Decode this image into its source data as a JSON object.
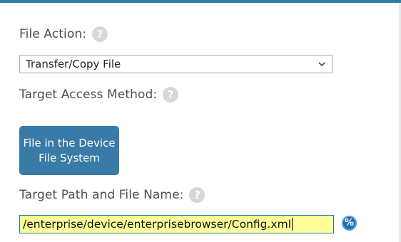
{
  "colors": {
    "accent_bar": "#2f7fa7",
    "button_bg": "#3a7aa6",
    "input_highlight": "#ffff99",
    "help_icon": "#d7d7d7"
  },
  "file_action": {
    "label": "File Action:",
    "help_icon": "?",
    "selected": "Transfer/Copy File",
    "chevron": "⌄"
  },
  "target_access": {
    "label": "Target Access Method:",
    "help_icon": "?",
    "button_line1": "File in the Device",
    "button_line2": "File System"
  },
  "target_path": {
    "label": "Target Path and File Name:",
    "help_icon": "?",
    "value": "/enterprise/device/enterprisebrowser/Config.xml",
    "browse_icon": "%"
  }
}
